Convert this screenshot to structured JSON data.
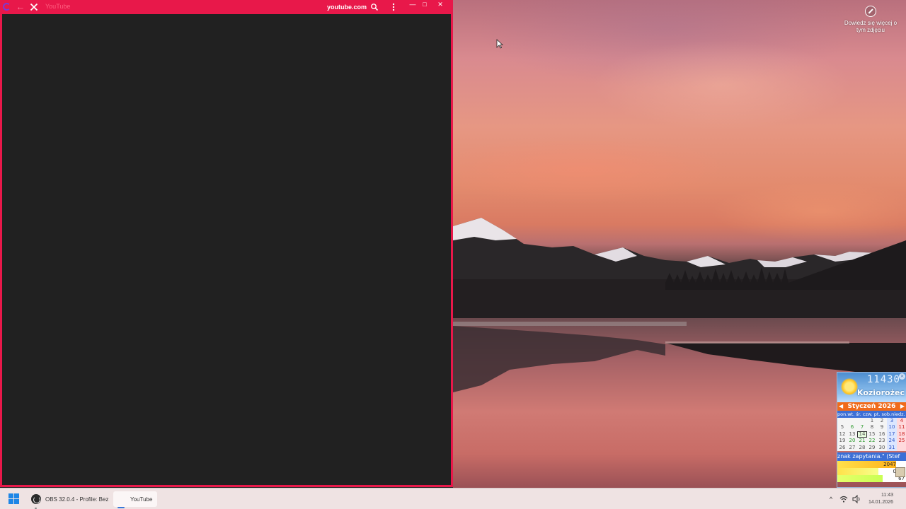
{
  "browser": {
    "url_label": "youtube.com",
    "title_faint": "YouTube",
    "back_symbol": "←",
    "minimize_symbol": "—",
    "maximize_symbol": "□",
    "close_symbol": "✕",
    "accent_color": "#e8184a",
    "content_bg": "#212121"
  },
  "desktop": {
    "spotlight_text_line1": "Dowiedz się więcej o",
    "spotlight_text_line2": "tym zdjęciu"
  },
  "gadget": {
    "time": "11430",
    "sign": "Koziorożec",
    "month_label": "Styczeń 2026",
    "weekdays_label": "pon.wt. śr. czw. pt. sob.niedz.",
    "ticker": "znak zapytania.\" (Stef",
    "bar1_value": "2047",
    "bar2_value": "0",
    "bar3_value": "67",
    "days": [
      [
        "",
        "",
        "",
        "1",
        "2",
        "3",
        "4"
      ],
      [
        "5",
        "6",
        "7",
        "8",
        "9",
        "10",
        "11"
      ],
      [
        "12",
        "13",
        "14",
        "15",
        "16",
        "17",
        "18"
      ],
      [
        "19",
        "20",
        "21",
        "22",
        "23",
        "24",
        "25"
      ],
      [
        "26",
        "27",
        "28",
        "29",
        "30",
        "31",
        ""
      ]
    ],
    "today": "14"
  },
  "taskbar": {
    "obs_label": "OBS 32.0.4 - Profile: Bez",
    "youtube_label": "YouTube",
    "clock_time": "11:43",
    "clock_date": "14.01.2026",
    "tray_chevron": "^"
  }
}
